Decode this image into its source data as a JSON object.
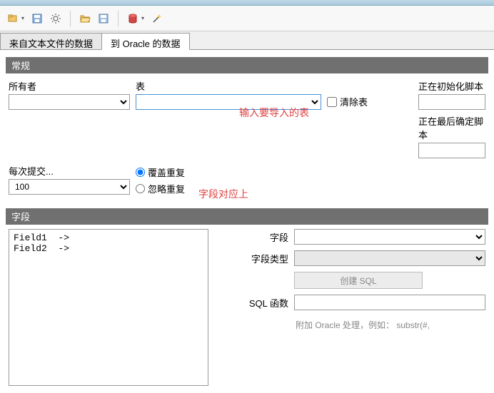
{
  "tabs": {
    "from_text": "来自文本文件的数据",
    "to_oracle": "到 Oracle 的数据"
  },
  "section": {
    "general": "常规",
    "fields": "字段"
  },
  "labels": {
    "owner": "所有者",
    "table": "表",
    "clear_table": "清除表",
    "init_script": "正在初始化脚本",
    "final_script": "正在最后确定脚本",
    "commit_every": "每次提交...",
    "overwrite": "覆盖重复",
    "ignore": "忽略重复",
    "field": "字段",
    "field_type": "字段类型",
    "create_sql": "创建 SQL",
    "sql_func": "SQL 函数",
    "note": "附加 Oracle 处理，例如： substr(#,"
  },
  "values": {
    "commit": "100"
  },
  "hints": {
    "input_table": "输入要导入的表",
    "field_match": "字段对应上"
  },
  "fields_list": "Field1  ->\nField2  ->"
}
